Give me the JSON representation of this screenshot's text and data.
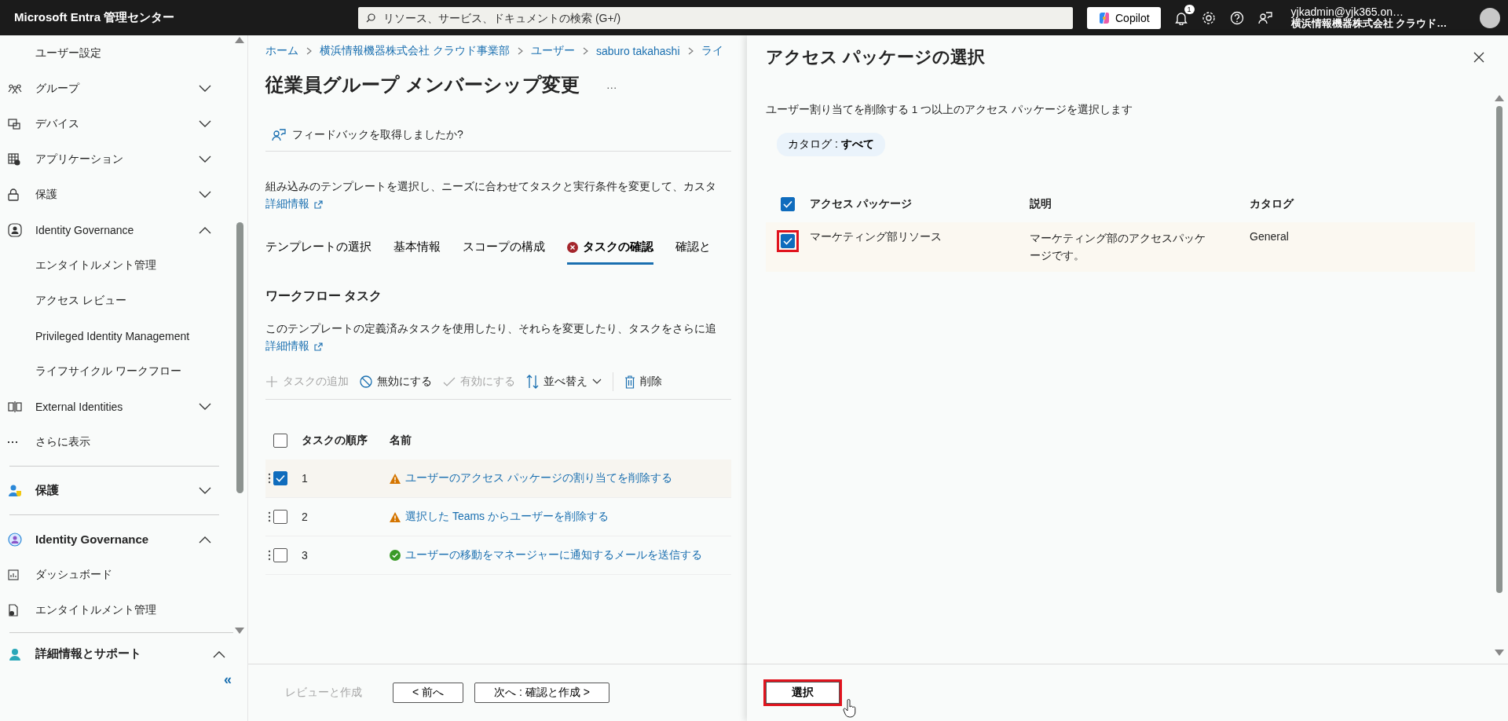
{
  "top_bar": {
    "brand": "Microsoft Entra 管理センター",
    "search": {
      "placeholder": "リソース、サービス、ドキュメントの検索 (G+/)"
    },
    "copilot": "Copilot",
    "notification_count": "1",
    "user": {
      "email": "yjkadmin@yjk365.on…",
      "org": "横浜情報機器株式会社 クラウド…"
    }
  },
  "sidebar": {
    "sections": [
      {
        "items": [
          {
            "kind": "sub",
            "label": "ユーザー設定",
            "bold": false
          },
          {
            "kind": "group",
            "label": "グループ",
            "bold": false,
            "expanded": false
          },
          {
            "kind": "device",
            "label": "デバイス",
            "bold": false,
            "expanded": false
          },
          {
            "kind": "app",
            "label": "アプリケーション",
            "bold": false,
            "expanded": false
          },
          {
            "kind": "lock",
            "label": "保護",
            "bold": false,
            "expanded": false
          },
          {
            "kind": "governance",
            "label": "Identity Governance",
            "bold": false,
            "expanded": true,
            "children": [
              {
                "label": "エンタイトルメント管理"
              },
              {
                "label": "アクセス レビュー"
              },
              {
                "label": "Privileged Identity Management"
              },
              {
                "label": "ライフサイクル ワークフロー"
              }
            ]
          },
          {
            "kind": "external",
            "label": "External Identities",
            "bold": false,
            "expanded": false
          },
          {
            "kind": "more",
            "label": "さらに表示",
            "bold": false
          }
        ]
      },
      {
        "items": [
          {
            "kind": "protect",
            "label": "保護",
            "bold": true,
            "expanded": false
          }
        ]
      },
      {
        "items": [
          {
            "kind": "governance-color",
            "label": "Identity Governance",
            "bold": true,
            "expanded": true,
            "children": [
              {
                "kind": "dashboard",
                "label": "ダッシュボード"
              },
              {
                "kind": "entitlement",
                "label": "エンタイトルメント管理"
              }
            ]
          }
        ]
      }
    ],
    "footer": {
      "kind": "support",
      "label": "詳細情報とサポート",
      "bold": true,
      "expanded": true
    },
    "collapse": "«"
  },
  "main": {
    "breadcrumb": [
      "ホーム",
      "横浜情報機器株式会社 クラウド事業部",
      "ユーザー",
      "saburo takahashi",
      "ライ"
    ],
    "title": "従業員グループ メンバーシップ変更",
    "more": "…",
    "feedback": "フィードバックを取得しましたか?",
    "description": "組み込みのテンプレートを選択し、ニーズに合わせてタスクと実行条件を変更して、カスタ",
    "learn_more": "詳細情報",
    "tabs": [
      {
        "label": "テンプレートの選択",
        "selected": false,
        "error": false
      },
      {
        "label": "基本情報",
        "selected": false,
        "error": false
      },
      {
        "label": "スコープの構成",
        "selected": false,
        "error": false
      },
      {
        "label": "タスクの確認",
        "selected": true,
        "error": true
      },
      {
        "label": "確認と",
        "selected": false,
        "error": false
      }
    ],
    "section_title": "ワークフロー タスク",
    "section_description": "このテンプレートの定義済みタスクを使用したり、それらを変更したり、タスクをさらに追",
    "section_learn_more": "詳細情報",
    "toolbar": [
      {
        "kind": "add",
        "label": "タスクの追加",
        "disabled": true
      },
      {
        "kind": "disable",
        "label": "無効にする",
        "disabled": false
      },
      {
        "kind": "enable",
        "label": "有効にする",
        "disabled": true
      },
      {
        "kind": "sort",
        "label": "並べ替え",
        "disabled": false
      },
      {
        "kind": "delete",
        "label": "削除",
        "disabled": false
      }
    ],
    "table": {
      "columns": [
        "タスクの順序",
        "名前"
      ],
      "all_selected": false,
      "rows": [
        {
          "order": "1",
          "name": "ユーザーのアクセス パッケージの割り当てを削除する",
          "kind": "warning",
          "selected": true
        },
        {
          "order": "2",
          "name": "選択した Teams からユーザーを削除する",
          "kind": "warning",
          "selected": false
        },
        {
          "order": "3",
          "name": "ユーザーの移動をマネージャーに通知するメールを送信する",
          "kind": "ok",
          "selected": false
        }
      ]
    },
    "footer": [
      {
        "label": "レビューと作成",
        "disabled": true
      },
      {
        "label": "< 前へ",
        "disabled": false
      },
      {
        "label": "次へ : 確認と作成 >",
        "disabled": false
      }
    ]
  },
  "panel": {
    "title": "アクセス パッケージの選択",
    "description": "ユーザー割り当てを削除する 1 つ以上のアクセス パッケージを選択します",
    "filter_label": "カタログ :",
    "filter_value": "すべて",
    "table": {
      "columns": [
        "アクセス パッケージ",
        "説明",
        "カタログ"
      ],
      "all_selected": true,
      "rows": [
        {
          "name": "マーケティング部リソース",
          "description": "マーケティング部のアクセスパッケージです。",
          "catalog": "General",
          "selected": true,
          "highlighted": true
        }
      ]
    },
    "select_button": {
      "label": "選択",
      "highlighted": true
    }
  }
}
